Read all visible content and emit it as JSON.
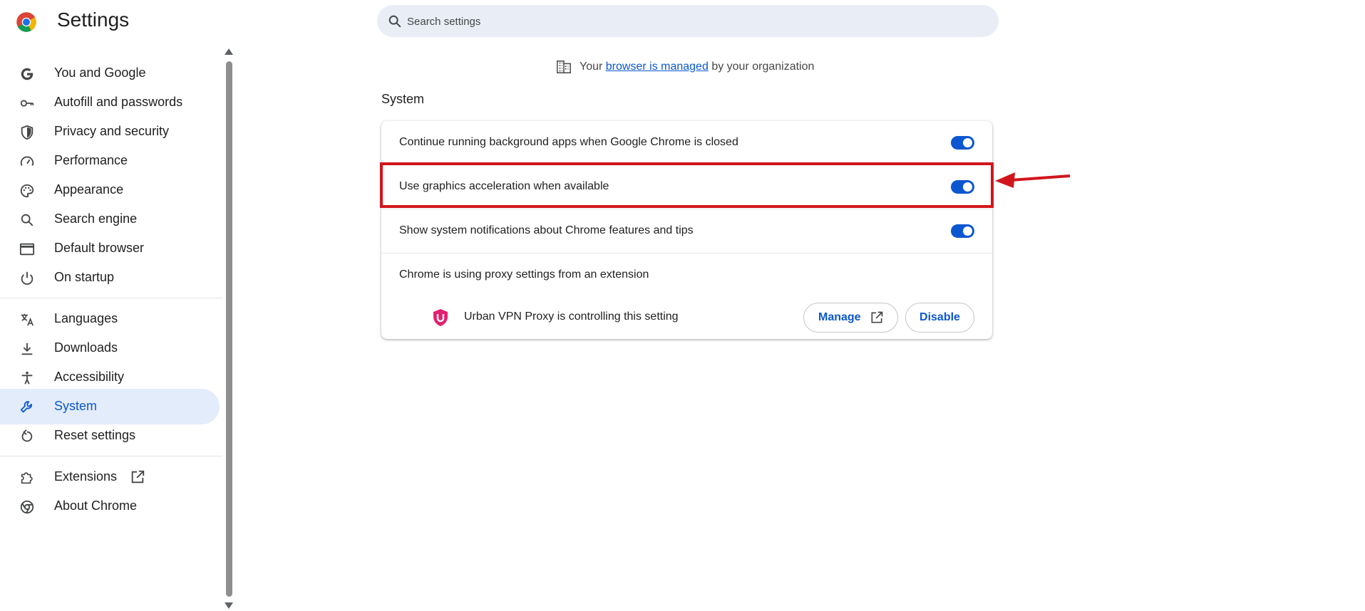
{
  "app": {
    "title": "Settings"
  },
  "search": {
    "placeholder": "Search settings",
    "value": ""
  },
  "managed_notice": {
    "prefix": "Your",
    "link": "browser is managed",
    "suffix": "by your organization"
  },
  "sidebar": {
    "items": [
      {
        "label": "You and Google",
        "icon": "google-g-icon"
      },
      {
        "label": "Autofill and passwords",
        "icon": "key-icon"
      },
      {
        "label": "Privacy and security",
        "icon": "shield-icon"
      },
      {
        "label": "Performance",
        "icon": "speedometer-icon"
      },
      {
        "label": "Appearance",
        "icon": "palette-icon"
      },
      {
        "label": "Search engine",
        "icon": "search-icon"
      },
      {
        "label": "Default browser",
        "icon": "browser-window-icon"
      },
      {
        "label": "On startup",
        "icon": "power-icon"
      },
      {
        "label": "Languages",
        "icon": "translate-icon"
      },
      {
        "label": "Downloads",
        "icon": "download-icon"
      },
      {
        "label": "Accessibility",
        "icon": "accessibility-icon"
      },
      {
        "label": "System",
        "icon": "wrench-icon",
        "selected": true
      },
      {
        "label": "Reset settings",
        "icon": "reset-icon"
      },
      {
        "label": "Extensions",
        "icon": "puzzle-icon"
      },
      {
        "label": "About Chrome",
        "icon": "chrome-icon"
      }
    ]
  },
  "system": {
    "title": "System",
    "settings": [
      {
        "label": "Continue running background apps when Google Chrome is closed",
        "enabled": true
      },
      {
        "label": "Use graphics acceleration when available",
        "enabled": true
      },
      {
        "label": "Show system notifications about Chrome features and tips",
        "enabled": true
      }
    ],
    "proxy": {
      "label": "Chrome is using proxy settings from an extension",
      "extension_text": "Urban VPN Proxy is controlling this setting",
      "manage_label": "Manage",
      "disable_label": "Disable"
    }
  },
  "colors": {
    "accent": "#0b57d0",
    "selected_bg": "#e3ecfb",
    "annotation": "#d2151c"
  }
}
